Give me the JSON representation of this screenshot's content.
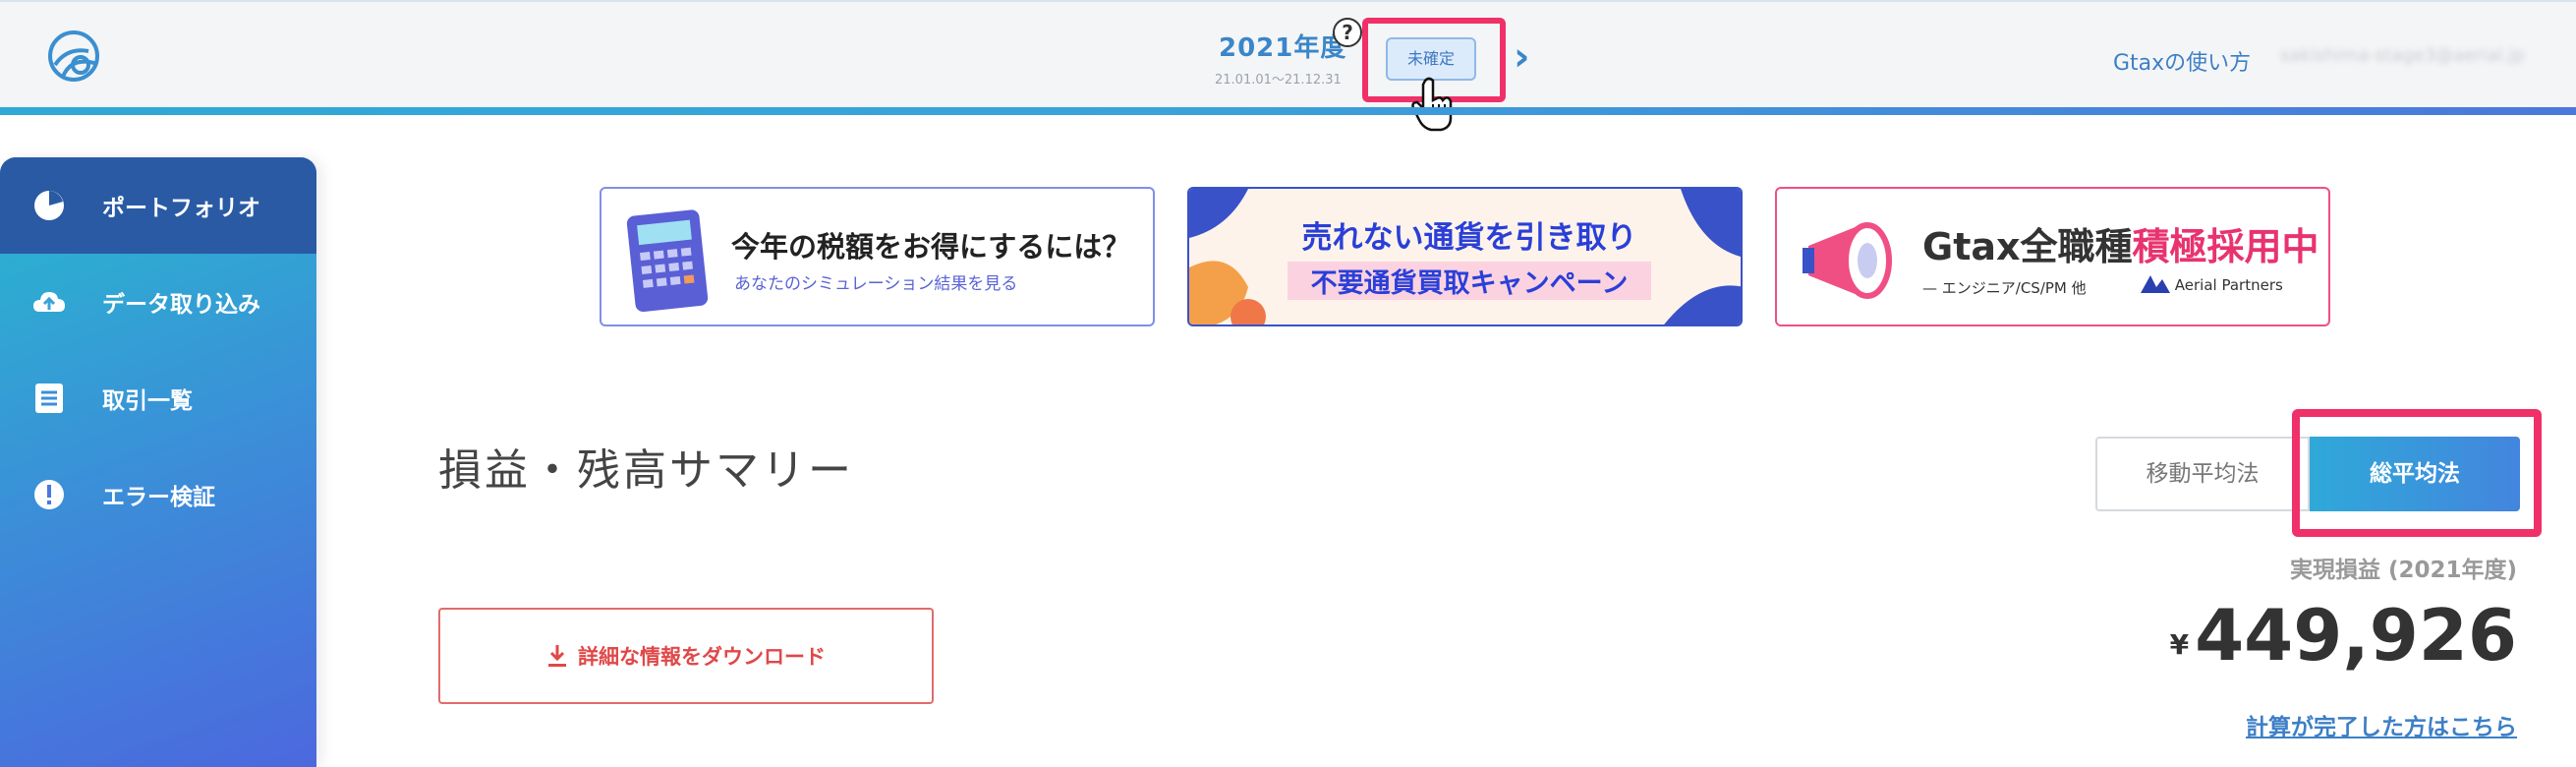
{
  "header": {
    "fiscal_year": "2021年度",
    "date_range": "21.01.01〜21.12.31",
    "help_glyph": "?",
    "status_badge": "未確定",
    "next_glyph": "›",
    "help_link": "Gtaxの使い方",
    "user_email": "sakishima-stage3@aerial.jp"
  },
  "sidebar": {
    "items": [
      {
        "label": "ポートフォリオ",
        "icon": "pie-chart-icon",
        "active": true
      },
      {
        "label": "データ取り込み",
        "icon": "cloud-upload-icon",
        "active": false
      },
      {
        "label": "取引一覧",
        "icon": "list-icon",
        "active": false
      },
      {
        "label": "エラー検証",
        "icon": "alert-icon",
        "active": false
      }
    ]
  },
  "banners": {
    "tax": {
      "title": "今年の税額をお得にするには？",
      "subtitle": "あなたのシミュレーション結果を見る"
    },
    "campaign": {
      "line1": "売れない通貨を引き取り",
      "line2": "不要通貨買取キャンペーン"
    },
    "recruit": {
      "brand": "Gtax",
      "title_black": "全職種",
      "title_pink": "積極採用中",
      "subtitle": "— エンジニア/CS/PM 他",
      "partner": "Aerial Partners"
    }
  },
  "main": {
    "title": "損益・残高サマリー",
    "method_moving": "移動平均法",
    "method_total": "総平均法",
    "realized_label": "実現損益 (2021年度)",
    "currency_symbol": "¥",
    "realized_value": "449,926",
    "calc_link": "計算が完了した方はこちら",
    "download_label": "詳細な情報をダウンロード"
  },
  "colors": {
    "accent_blue": "#3a86c8",
    "highlight_pink": "#f03068",
    "sidebar_active": "#2a5aa4",
    "download_red": "#e04848"
  }
}
